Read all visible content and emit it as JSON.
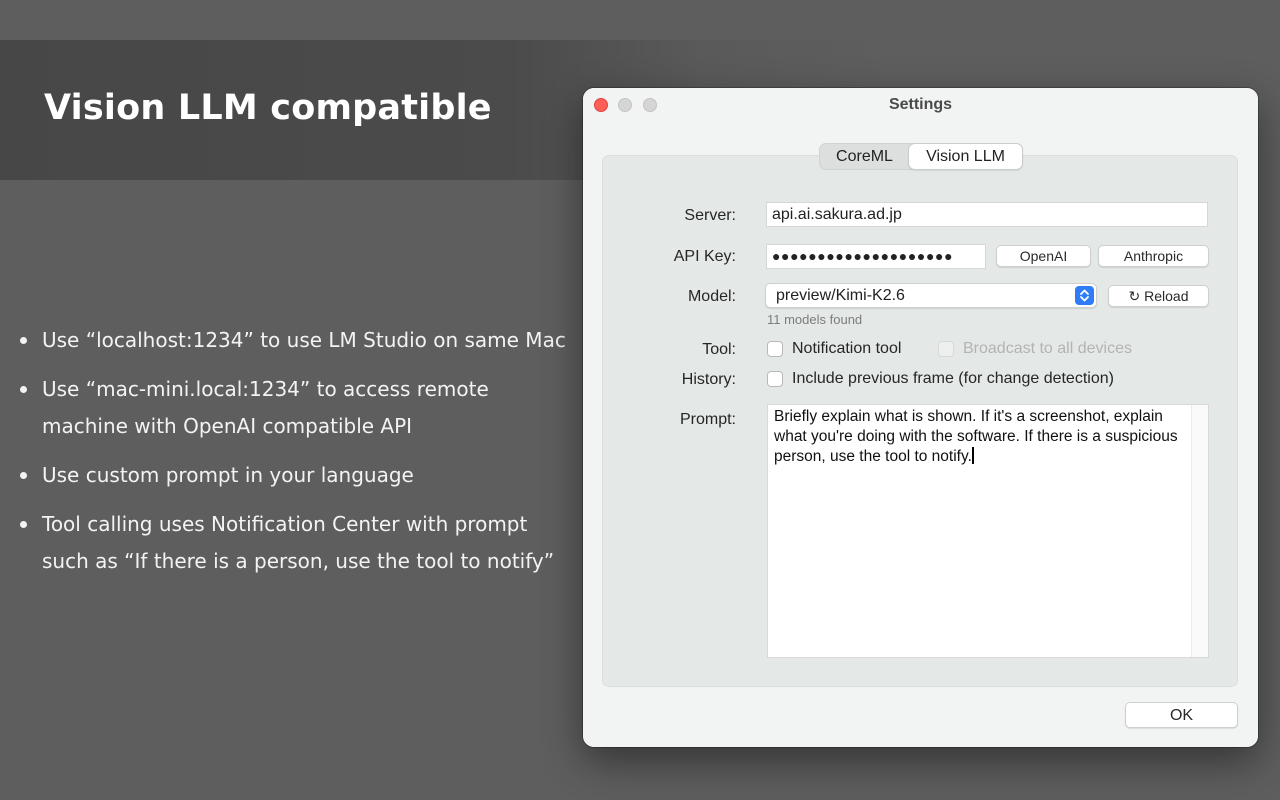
{
  "slide": {
    "headline": "Vision LLM compatible",
    "bullets": [
      "Use “localhost:1234” to use LM Studio on same Mac",
      "Use “mac-mini.local:1234” to access remote machine with OpenAI compatible API",
      "Use custom prompt in your language",
      "Tool calling uses Notification Center with prompt such as “If there is a person, use the tool to notify”"
    ]
  },
  "window": {
    "title": "Settings",
    "tabs": [
      "CoreML",
      "Vision LLM"
    ],
    "selected_tab": "Vision LLM",
    "server": {
      "label": "Server:",
      "value": "api.ai.sakura.ad.jp"
    },
    "api_key": {
      "label": "API Key:",
      "masked_value": "●●●●●●●●●●●●●●●●●●●●",
      "openai_button": "OpenAI",
      "anthropic_button": "Anthropic"
    },
    "model": {
      "label": "Model:",
      "selected": "preview/Kimi-K2.6",
      "reload_button": "Reload",
      "hint": "11 models found"
    },
    "tool": {
      "label": "Tool:",
      "notification_label": "Notification tool",
      "notification_checked": false,
      "broadcast_label": "Broadcast to all devices",
      "broadcast_checked": false,
      "broadcast_enabled": false
    },
    "history": {
      "label": "History:",
      "include_label": "Include previous frame (for change detection)",
      "include_checked": false
    },
    "prompt": {
      "label": "Prompt:",
      "value": "Briefly explain what is shown. If it's a screenshot, explain what you're doing with the software. If there is a suspicious person, use the tool to notify."
    },
    "ok_button": "OK"
  },
  "colors": {
    "accent": "#2f7cf6",
    "close_light": "#fe5f57",
    "background": "#5e5e5e"
  }
}
